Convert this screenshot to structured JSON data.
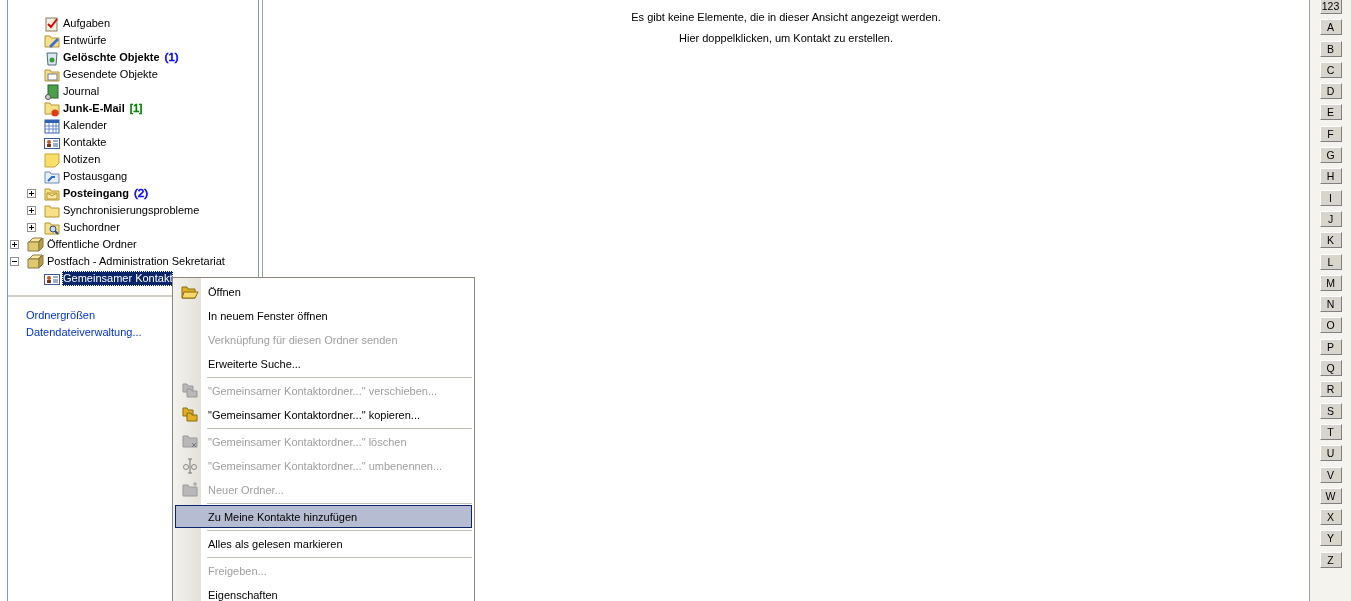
{
  "folder_tree": [
    {
      "children": [
        {
          "label": "Aufgaben",
          "kind": "tasks",
          "unread": false,
          "selected": false
        },
        {
          "label": "Entwürfe",
          "kind": "drafts",
          "unread": false,
          "selected": false
        },
        {
          "label": "Gelöschte Objekte",
          "kind": "deleted",
          "unread": true,
          "selected": false,
          "count": "(1)",
          "color": "#0000ff"
        },
        {
          "label": "Gesendete Objekte",
          "kind": "sent",
          "unread": false,
          "selected": false
        },
        {
          "label": "Journal",
          "kind": "journal",
          "unread": false,
          "selected": false
        },
        {
          "label": "Junk-E-Mail",
          "kind": "junk",
          "unread": true,
          "selected": false,
          "count": "[1]",
          "color": "#008000"
        },
        {
          "label": "Kalender",
          "kind": "calendar",
          "unread": false,
          "selected": false
        },
        {
          "label": "Kontakte",
          "kind": "contacts",
          "unread": false,
          "selected": false
        },
        {
          "label": "Notizen",
          "kind": "notes",
          "unread": false,
          "selected": false
        },
        {
          "label": "Postausgang",
          "kind": "outbox",
          "unread": false,
          "selected": false
        },
        {
          "label": "Posteingang",
          "kind": "inbox",
          "unread": true,
          "selected": false,
          "count": "(2)",
          "color": "#0000ff",
          "expanded": false
        },
        {
          "label": "Synchronisierungsprobleme",
          "kind": "folder",
          "unread": false,
          "selected": false,
          "expanded": false
        },
        {
          "label": "Suchordner",
          "kind": "search",
          "unread": false,
          "selected": false,
          "expanded": false
        }
      ]
    },
    {
      "label": "Öffentliche Ordner",
      "kind": "public",
      "unread": false,
      "selected": false,
      "expanded": false
    },
    {
      "label": "Postfach - Administration Sekretariat",
      "kind": "public",
      "unread": false,
      "selected": false,
      "expanded": true,
      "children": [
        {
          "label": "Gemeinsamer Kontakt",
          "kind": "contacts",
          "unread": false,
          "selected": true
        }
      ]
    }
  ],
  "pane_links": [
    "Ordnergrößen",
    "Datendateiverwaltung..."
  ],
  "empty_view": {
    "message": "Es gibt keine Elemente, die in dieser Ansicht angezeigt werden.",
    "hint": "Hier doppelklicken, um Kontakt zu erstellen."
  },
  "alphabet_index": [
    "123",
    "A",
    "B",
    "C",
    "D",
    "E",
    "F",
    "G",
    "H",
    "I",
    "J",
    "K",
    "L",
    "M",
    "N",
    "O",
    "P",
    "Q",
    "R",
    "S",
    "T",
    "U",
    "V",
    "W",
    "X",
    "Y",
    "Z"
  ],
  "context_menu": [
    {
      "kind": "open",
      "label": "Öffnen",
      "disabled": false,
      "selected": false
    },
    {
      "kind": "plain",
      "label": "In neuem Fenster öffnen",
      "disabled": false,
      "selected": false
    },
    {
      "kind": "plain",
      "label": "Verknüpfung für diesen Ordner senden",
      "disabled": true,
      "selected": false
    },
    {
      "kind": "plain",
      "label": "Erweiterte Suche...",
      "disabled": false,
      "selected": false
    },
    {
      "kind": "separator"
    },
    {
      "kind": "move",
      "label": "\"Gemeinsamer Kontaktordner...\" verschieben...",
      "disabled": true,
      "selected": false
    },
    {
      "kind": "copy",
      "label": "\"Gemeinsamer Kontaktordner...\" kopieren...",
      "disabled": false,
      "selected": false
    },
    {
      "kind": "separator"
    },
    {
      "kind": "delete",
      "label": "\"Gemeinsamer Kontaktordner...\" löschen",
      "disabled": true,
      "selected": false
    },
    {
      "kind": "rename",
      "label": "\"Gemeinsamer Kontaktordner...\" umbenennen...",
      "disabled": true,
      "selected": false
    },
    {
      "kind": "newfolder",
      "label": "Neuer Ordner...",
      "disabled": true,
      "selected": false
    },
    {
      "kind": "separator"
    },
    {
      "kind": "plain",
      "label": "Zu Meine Kontakte hinzufügen",
      "disabled": false,
      "selected": true
    },
    {
      "kind": "separator"
    },
    {
      "kind": "plain",
      "label": "Alles als gelesen markieren",
      "disabled": false,
      "selected": false
    },
    {
      "kind": "separator"
    },
    {
      "kind": "plain",
      "label": "Freigeben...",
      "disabled": true,
      "selected": false
    },
    {
      "kind": "plain",
      "label": "Eigenschaften",
      "disabled": false,
      "selected": false
    }
  ]
}
